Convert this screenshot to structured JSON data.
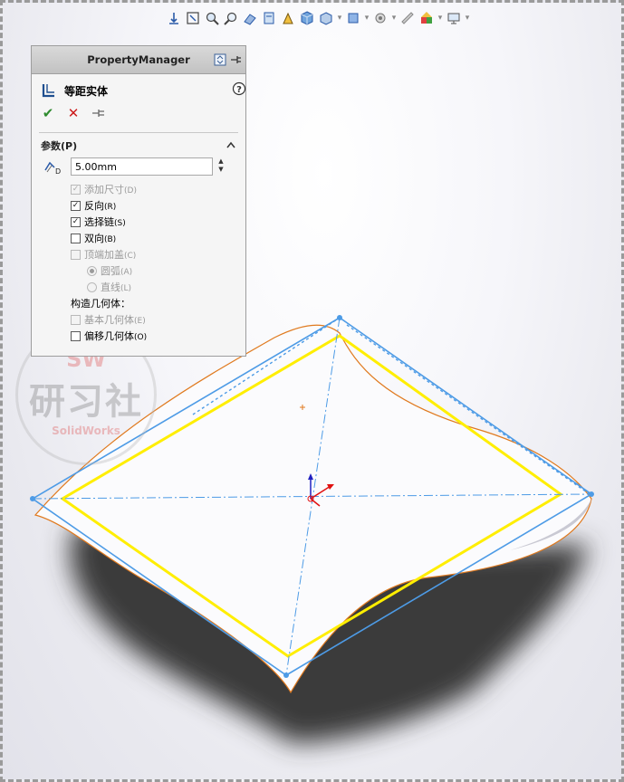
{
  "toolbar": {
    "icons": [
      "view-orientation-icon",
      "zoom-to-fit-icon",
      "zoom-area-icon",
      "previous-view-icon",
      "section-view-icon",
      "dynamic-annotation-icon",
      "view-settings-icon",
      "display-style-icon",
      "hide-show-icon",
      "edit-appearance-icon",
      "apply-scene-icon",
      "view-settings-monitor-icon"
    ]
  },
  "property_manager": {
    "header_title": "PropertyManager",
    "feature_title": "等距实体",
    "group_title": "参数(P)",
    "distance_value": "5.00mm",
    "distance_icon_label": "D",
    "options": {
      "add_dimensions": {
        "label": "添加尺寸",
        "shortcut": "(D)",
        "checked": true,
        "enabled": false
      },
      "reverse": {
        "label": "反向",
        "shortcut": "(R)",
        "checked": true,
        "enabled": true
      },
      "select_chain": {
        "label": "选择链",
        "shortcut": "(S)",
        "checked": true,
        "enabled": true
      },
      "bidirectional": {
        "label": "双向",
        "shortcut": "(B)",
        "checked": false,
        "enabled": true
      },
      "cap_ends": {
        "label": "顶端加盖",
        "shortcut": "(C)",
        "checked": false,
        "enabled": false
      },
      "arc": {
        "label": "圆弧",
        "shortcut": "(A)",
        "selected": true,
        "enabled": false
      },
      "line": {
        "label": "直线",
        "shortcut": "(L)",
        "selected": false,
        "enabled": false
      },
      "build_geometry_label": "构造几何体：",
      "base_geometry": {
        "label": "基本几何体",
        "shortcut": "(E)",
        "checked": false,
        "enabled": false
      },
      "offset_geometry": {
        "label": "偏移几何体",
        "shortcut": "(O)",
        "checked": false,
        "enabled": true
      }
    }
  },
  "watermark": {
    "top": "SW",
    "middle": "研习社",
    "bottom": "SolidWorks"
  },
  "colors": {
    "surface_edge": "#e07a1f",
    "sketch_blue": "#4d9be6",
    "offset_yellow": "#ffee00",
    "axis_red": "#e01010",
    "axis_blue": "#2020c0",
    "shadow": "#3a3a3a"
  }
}
